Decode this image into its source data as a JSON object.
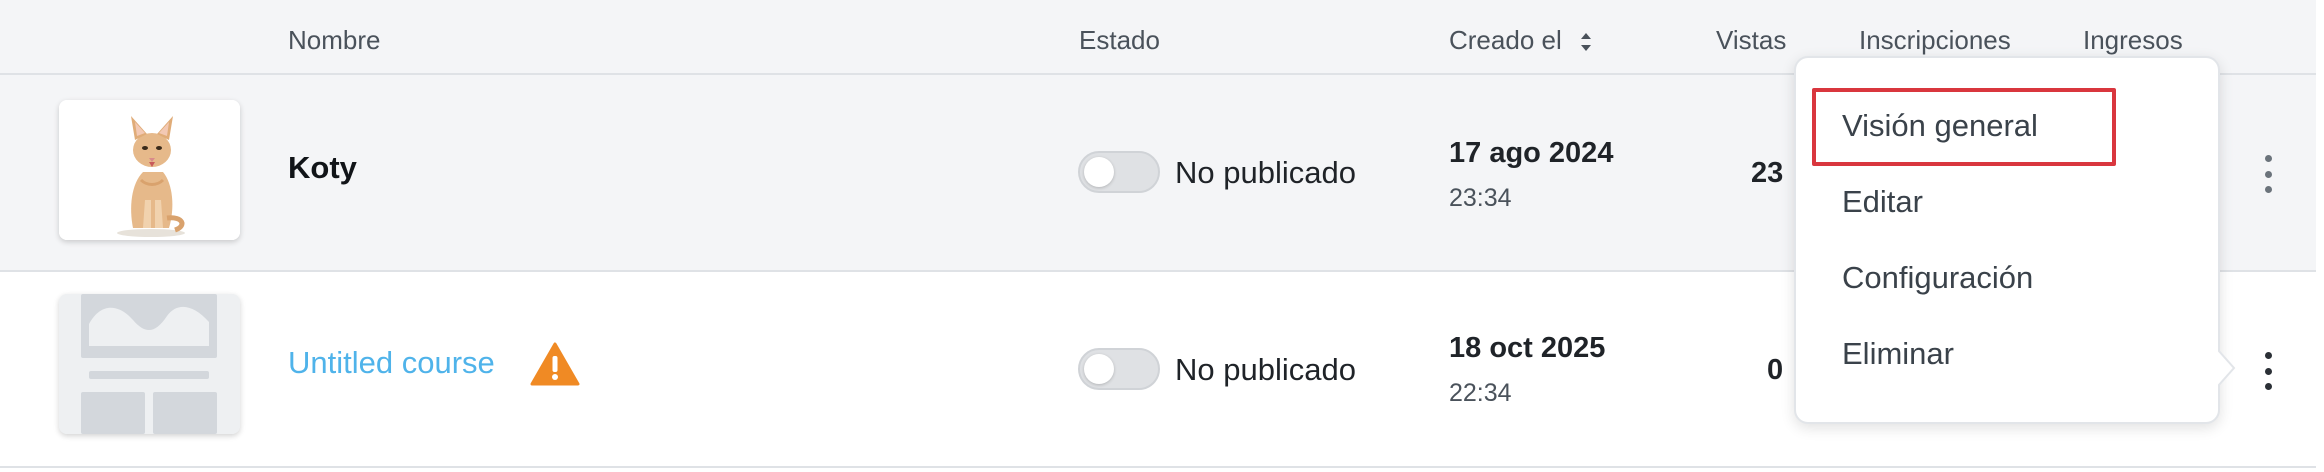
{
  "table": {
    "columns": {
      "name": "Nombre",
      "status": "Estado",
      "created": "Creado el",
      "views": "Vistas",
      "enrollments": "Inscripciones",
      "revenue": "Ingresos"
    },
    "sort_icon": "sort-updown-icon",
    "rows": [
      {
        "name": "Koty",
        "status": "No publicado",
        "published": false,
        "date": "17 ago 2024",
        "time": "23:34",
        "views": "23",
        "thumbnail": "cat-photo"
      },
      {
        "name": "Untitled course",
        "status": "No publicado",
        "published": false,
        "date": "18 oct 2025",
        "time": "22:34",
        "views": "0",
        "thumbnail": "placeholder-image",
        "warning_icon": "warning-icon"
      }
    ]
  },
  "menu": {
    "items": [
      "Visión general",
      "Editar",
      "Configuración",
      "Eliminar"
    ],
    "highlighted": "Visión general"
  },
  "colors": {
    "link": "#4fb3ea",
    "warning": "#f08a24",
    "highlight_border": "#d9363e",
    "row_selected_bg": "#f4f5f7"
  }
}
